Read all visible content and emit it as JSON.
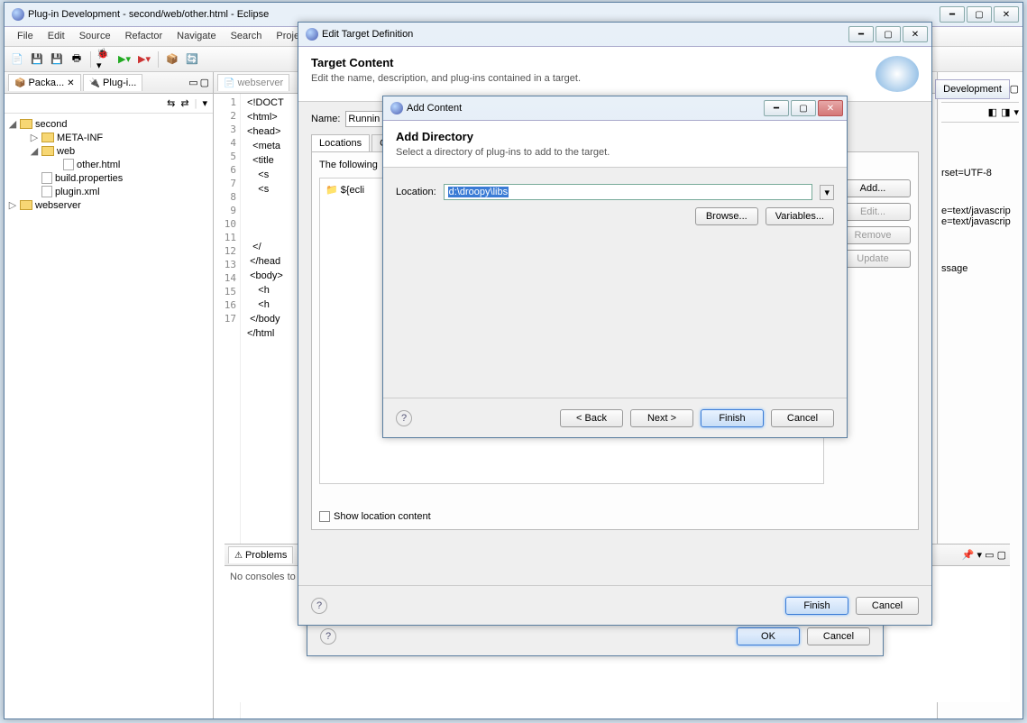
{
  "main_window": {
    "title": "Plug-in Development - second/web/other.html - Eclipse",
    "menus": [
      "File",
      "Edit",
      "Source",
      "Refactor",
      "Navigate",
      "Search",
      "Proje"
    ],
    "perspective": "Development"
  },
  "package_explorer": {
    "tab1": "Packa...",
    "tab2": "Plug-i...",
    "tree": {
      "project": "second",
      "meta": "META-INF",
      "web": "web",
      "file1": "other.html",
      "file2": "build.properties",
      "file3": "plugin.xml",
      "project2": "webserver"
    }
  },
  "editor": {
    "tab": "webserver",
    "lines": [
      " <!DOCT",
      " <html>",
      " <head>",
      "   <meta ",
      "   <title",
      "     <s",
      "     <s",
      "",
      "",
      "",
      "   </",
      "  </head",
      "  <body>",
      "     <h",
      "     <h",
      "  </body",
      " </html"
    ]
  },
  "outline": {
    "items": [
      "rset=UTF-8",
      "e=text/javascrip",
      "e=text/javascrip",
      "",
      "ssage"
    ]
  },
  "problems_view": {
    "tab": "Problems",
    "msg": "No consoles to"
  },
  "target_dialog": {
    "title": "Edit Target Definition",
    "header": "Target Content",
    "sub": "Edit the name, description, and plug-ins contained in a target.",
    "name_label": "Name:",
    "name_value": "Runnin",
    "tab_locations": "Locations",
    "tab_other": "C",
    "list_intro": "The following",
    "list_item": "${ecli",
    "btn_add": "Add...",
    "btn_edit": "Edit...",
    "btn_remove": "Remove",
    "btn_update": "Update",
    "show_loc": "Show location content",
    "finish": "Finish",
    "cancel": "Cancel",
    "ok": "OK"
  },
  "add_content": {
    "title": "Add Content",
    "header": "Add Directory",
    "sub": "Select a directory of plug-ins to add to the target.",
    "loc_label": "Location:",
    "loc_value": "d:\\droopy\\libs",
    "browse": "Browse...",
    "variables": "Variables...",
    "back": "< Back",
    "next": "Next >",
    "finish": "Finish",
    "cancel": "Cancel"
  }
}
